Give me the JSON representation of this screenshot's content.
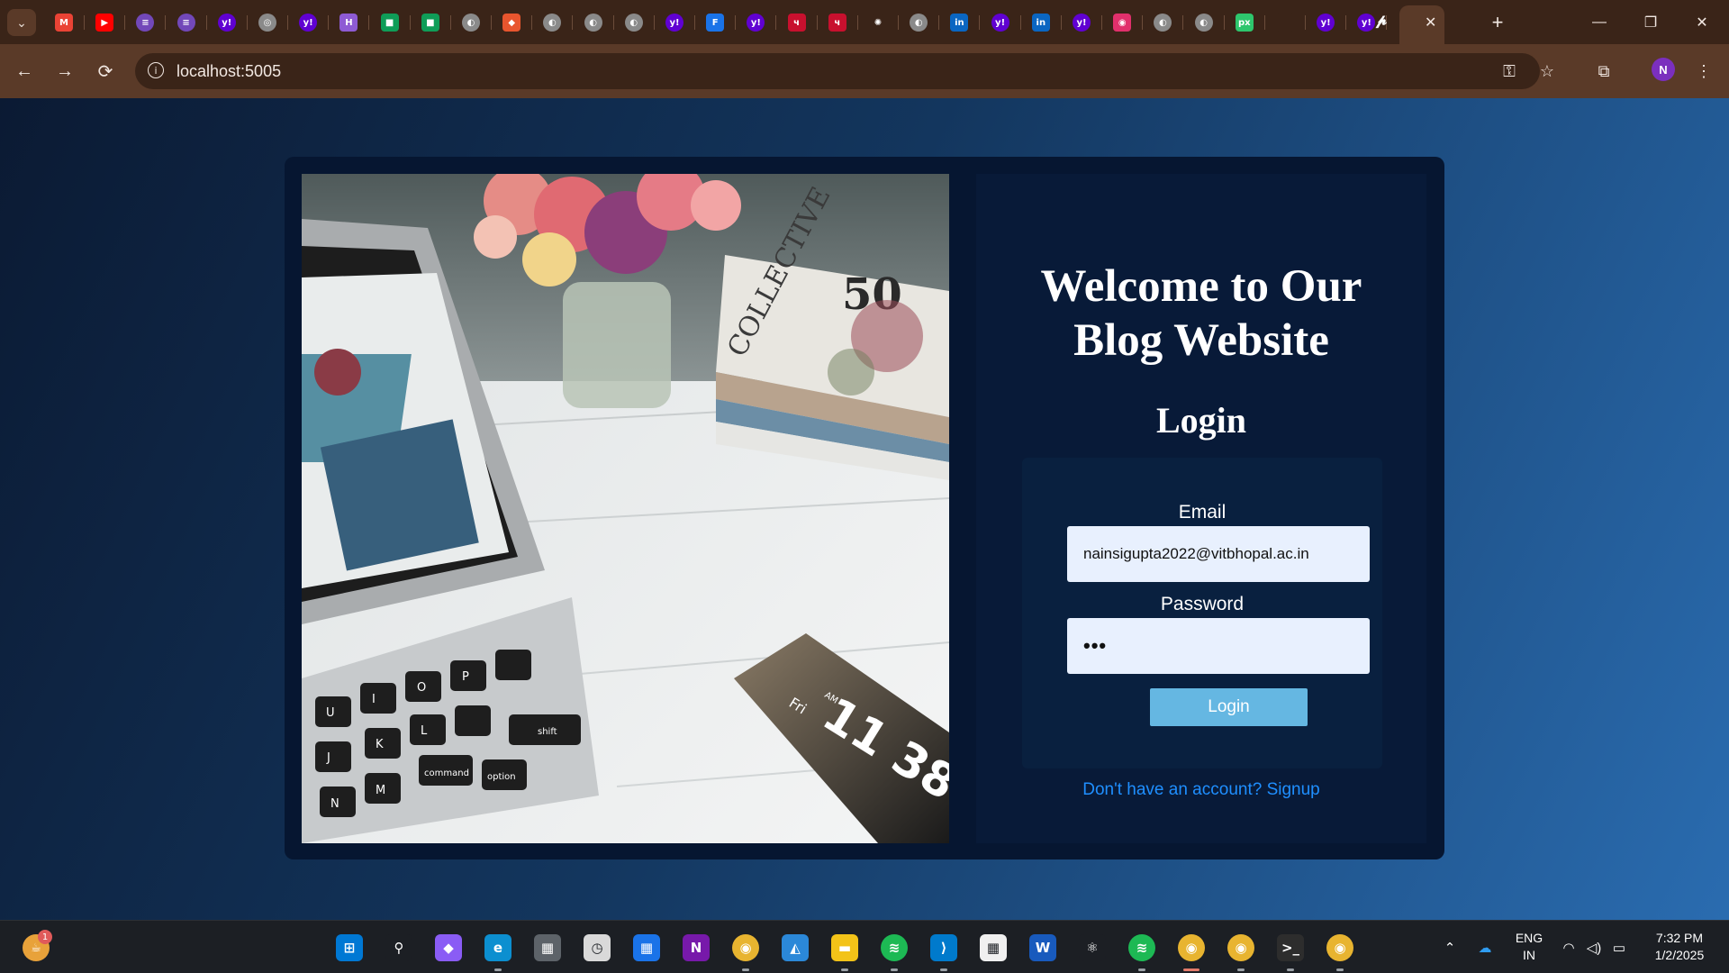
{
  "browser": {
    "url": "localhost:5005",
    "profile_initial": "N",
    "tab_count_note": ""
  },
  "tabs": [
    {
      "icon": "gmail-icon",
      "glyph": "M",
      "color": "#ea4335"
    },
    {
      "icon": "youtube-icon",
      "glyph": "▶",
      "color": "#ff0000"
    },
    {
      "icon": "forms-icon",
      "glyph": "≡",
      "color": "#7248b9"
    },
    {
      "icon": "forms-icon",
      "glyph": "≡",
      "color": "#7248b9"
    },
    {
      "icon": "yahoo-icon",
      "glyph": "y!",
      "color": "#6001d2"
    },
    {
      "icon": "generic-site-icon",
      "glyph": "◎",
      "color": "#8a8a8a"
    },
    {
      "icon": "yahoo-icon",
      "glyph": "y!",
      "color": "#6001d2"
    },
    {
      "icon": "hackerrank-icon",
      "glyph": "H",
      "color": "#8e5bd4"
    },
    {
      "icon": "meet-icon",
      "glyph": "■",
      "color": "#0f9d58"
    },
    {
      "icon": "meet-icon",
      "glyph": "■",
      "color": "#0f9d58"
    },
    {
      "icon": "globe-icon",
      "glyph": "◐",
      "color": "#8a8a8a"
    },
    {
      "icon": "site-icon",
      "glyph": "◆",
      "color": "#e8552e"
    },
    {
      "icon": "globe-icon",
      "glyph": "◐",
      "color": "#8a8a8a"
    },
    {
      "icon": "globe-icon",
      "glyph": "◐",
      "color": "#8a8a8a"
    },
    {
      "icon": "globe-icon",
      "glyph": "◐",
      "color": "#8a8a8a"
    },
    {
      "icon": "yahoo-icon",
      "glyph": "y!",
      "color": "#6001d2"
    },
    {
      "icon": "font-icon",
      "glyph": "F",
      "color": "#1a73e8"
    },
    {
      "icon": "yahoo-icon",
      "glyph": "y!",
      "color": "#6001d2"
    },
    {
      "icon": "bank-icon",
      "glyph": "ч",
      "color": "#c8102e"
    },
    {
      "icon": "bank-icon",
      "glyph": "ч",
      "color": "#c8102e"
    },
    {
      "icon": "openai-icon",
      "glyph": "✺",
      "color": "#3a2418"
    },
    {
      "icon": "globe-icon",
      "glyph": "◐",
      "color": "#8a8a8a"
    },
    {
      "icon": "linkedin-icon",
      "glyph": "in",
      "color": "#0a66c2"
    },
    {
      "icon": "yahoo-icon",
      "glyph": "y!",
      "color": "#6001d2"
    },
    {
      "icon": "linkedin-icon",
      "glyph": "in",
      "color": "#0a66c2"
    },
    {
      "icon": "yahoo-icon",
      "glyph": "y!",
      "color": "#6001d2"
    },
    {
      "icon": "instagram-icon",
      "glyph": "◉",
      "color": "#e1306c"
    },
    {
      "icon": "globe-icon",
      "glyph": "◐",
      "color": "#8a8a8a"
    },
    {
      "icon": "globe-icon",
      "glyph": "◐",
      "color": "#8a8a8a"
    },
    {
      "icon": "pixabay-icon",
      "glyph": "px",
      "color": "#2ec66d"
    },
    {
      "icon": "blank-icon",
      "glyph": "",
      "color": "#3a2418"
    },
    {
      "icon": "yahoo-icon",
      "glyph": "y!",
      "color": "#6001d2"
    },
    {
      "icon": "yahoo-icon",
      "glyph": "y!",
      "color": "#6001d2"
    },
    {
      "icon": "paytm-icon",
      "glyph": "₽",
      "color": "#3a2418"
    }
  ],
  "page": {
    "welcome_line1": "Welcome to Our",
    "welcome_line2": "Blog Website",
    "login_title": "Login",
    "email_label": "Email",
    "email_value": "nainsigupta2022@vitbhopal.ac.in",
    "password_label": "Password",
    "password_value": "•••",
    "login_button": "Login",
    "signup_link": "Don't have an account? Signup"
  },
  "photo": {
    "clock_day": "Fri",
    "clock_time": "11 38",
    "clock_ampm": "AM",
    "magazine_title": "COLLECTIVE",
    "magazine_number": "50",
    "keys": [
      "N",
      "M",
      "J",
      "K",
      "U",
      "I",
      "O",
      "P",
      "L",
      "command",
      "option",
      "shift"
    ]
  },
  "taskbar": {
    "notif_count": "1",
    "lang_line1": "ENG",
    "lang_line2": "IN",
    "time": "7:32 PM",
    "date": "1/2/2025",
    "apps": [
      {
        "name": "start",
        "color": "#0078d4",
        "glyph": "⊞"
      },
      {
        "name": "search",
        "color": "#1c1f24",
        "glyph": "⚲"
      },
      {
        "name": "copilot",
        "color": "#8a5cf5",
        "glyph": "◆"
      },
      {
        "name": "edge",
        "color": "#0c8fd0",
        "glyph": "e"
      },
      {
        "name": "calculator",
        "color": "#5d6369",
        "glyph": "▦"
      },
      {
        "name": "clock",
        "color": "#d9d9d9",
        "glyph": "◷"
      },
      {
        "name": "calendar",
        "color": "#1a73e8",
        "glyph": "▦"
      },
      {
        "name": "onenote",
        "color": "#7719aa",
        "glyph": "N"
      },
      {
        "name": "chrome",
        "color": "#e8b430",
        "glyph": "◉"
      },
      {
        "name": "photos",
        "color": "#2b88d8",
        "glyph": "◭"
      },
      {
        "name": "file-explorer",
        "color": "#f3c318",
        "glyph": "▬"
      },
      {
        "name": "spotify",
        "color": "#1db954",
        "glyph": "≋"
      },
      {
        "name": "vscode",
        "color": "#007acc",
        "glyph": "⟩"
      },
      {
        "name": "store",
        "color": "#f0f0f0",
        "glyph": "▦"
      },
      {
        "name": "word",
        "color": "#185abd",
        "glyph": "W"
      },
      {
        "name": "react",
        "color": "#1c1f24",
        "glyph": "⚛"
      },
      {
        "name": "spotify",
        "color": "#1db954",
        "glyph": "≋"
      },
      {
        "name": "chrome-profile-n",
        "color": "#e8b430",
        "glyph": "◉"
      },
      {
        "name": "chrome-profile-n",
        "color": "#e8b430",
        "glyph": "◉"
      },
      {
        "name": "terminal",
        "color": "#2d2d2d",
        "glyph": ">_"
      },
      {
        "name": "chrome-profile-n",
        "color": "#e8b430",
        "glyph": "◉"
      }
    ]
  }
}
